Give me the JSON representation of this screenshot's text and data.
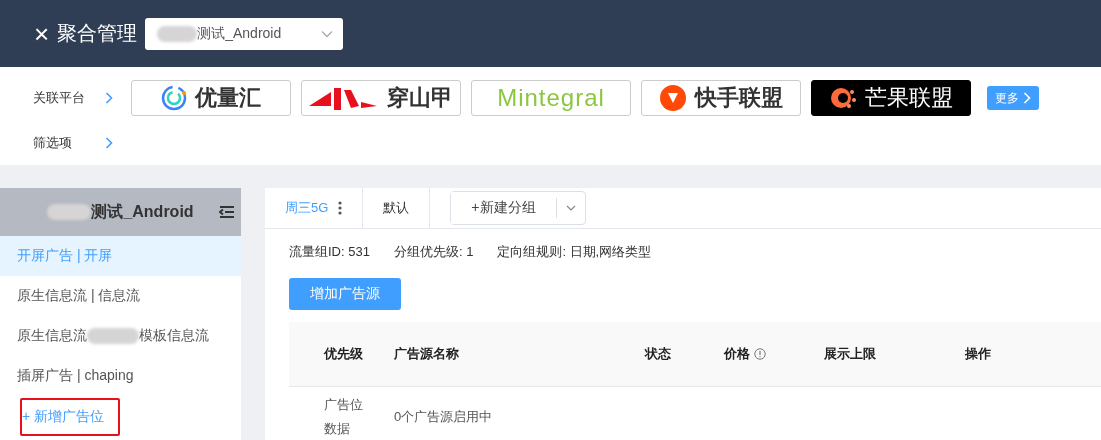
{
  "header": {
    "close": "×",
    "title": "聚合管理",
    "app_select": {
      "value": "测试_Android",
      "redacted": true
    }
  },
  "platforms": {
    "label": "关联平台",
    "items": [
      {
        "name": "优量汇",
        "kind": "ylh"
      },
      {
        "name": "穿山甲",
        "kind": "csj"
      },
      {
        "name": "Mintegral",
        "kind": "mtg"
      },
      {
        "name": "快手联盟",
        "kind": "ks"
      },
      {
        "name": "芒果联盟",
        "kind": "mg"
      }
    ],
    "more": "更多"
  },
  "filter": {
    "label": "筛选项"
  },
  "sidebar": {
    "title": "测试_Android",
    "title_redacted": true,
    "items": [
      {
        "parts": [
          "开屏广告 | 开屏"
        ],
        "selected": true
      },
      {
        "parts": [
          "原生信息流 | 信息流"
        ],
        "selected": false
      },
      {
        "parts": [
          "原生信息流",
          "模板信息流"
        ],
        "selected": false
      },
      {
        "parts": [
          "插屏广告 | chaping"
        ],
        "selected": false
      }
    ],
    "add": "+ 新增广告位",
    "add_highlighted": true
  },
  "tabs": [
    {
      "label": "周三5G",
      "selected": true,
      "menu": true
    },
    {
      "label": "默认",
      "selected": false,
      "menu": false
    }
  ],
  "new_group": "+新建分组",
  "info": [
    "流量组ID: 531",
    "分组优先级: 1",
    "定向组规则: 日期,网络类型"
  ],
  "add_source": "增加广告源",
  "table": {
    "columns": [
      {
        "label": "优先级"
      },
      {
        "label": "广告源名称"
      },
      {
        "label": "状态"
      },
      {
        "label": "价格",
        "info": true
      },
      {
        "label": "展示上限"
      },
      {
        "label": "操作"
      }
    ],
    "rows": [
      [
        "广告位数据",
        "0个广告源启用中"
      ]
    ]
  }
}
